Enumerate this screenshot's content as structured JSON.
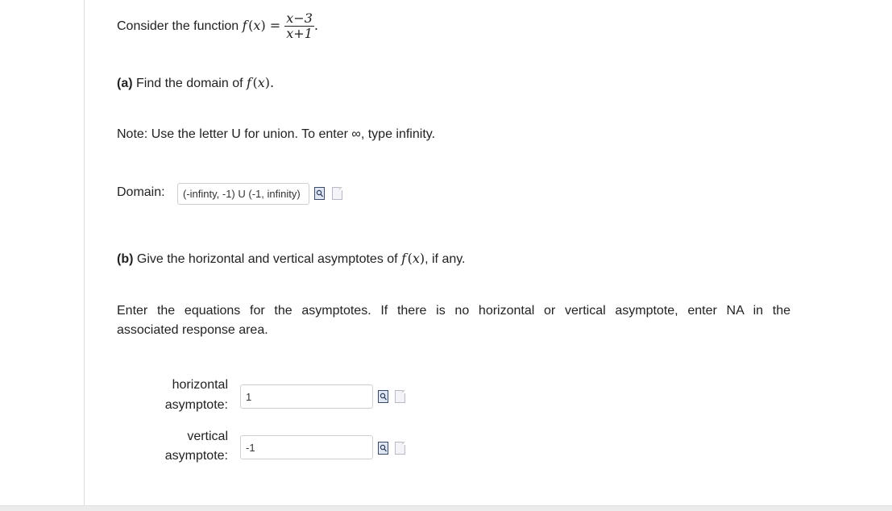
{
  "intro": {
    "prefix": "Consider the function",
    "func": "f",
    "var": "x",
    "numerator": "x−3",
    "denominator": "x+1"
  },
  "part_a": {
    "tag": "(a)",
    "text": "Find the domain of"
  },
  "note": {
    "before": "Note: Use the letter U for union. To enter",
    "symbol": "∞",
    "after": ", type infinity."
  },
  "domain": {
    "label": "Domain:",
    "value": "(-infinty, -1) U (-1, infinity)"
  },
  "part_b": {
    "tag": "(b)",
    "text": "Give the horizontal and vertical asymptotes of",
    "suffix": ", if any."
  },
  "instructions": {
    "line1": "Enter the equations for the asymptotes. If there is no horizontal or vertical asymptote, enter NA in the",
    "line2": "associated response area."
  },
  "horizontal": {
    "label_line1": "horizontal",
    "label_line2": "asymptote:",
    "value": "1"
  },
  "vertical": {
    "label_line1": "vertical",
    "label_line2": "asymptote:",
    "value": "-1"
  },
  "icons": {
    "preview": "preview-icon",
    "help": "help-icon"
  }
}
